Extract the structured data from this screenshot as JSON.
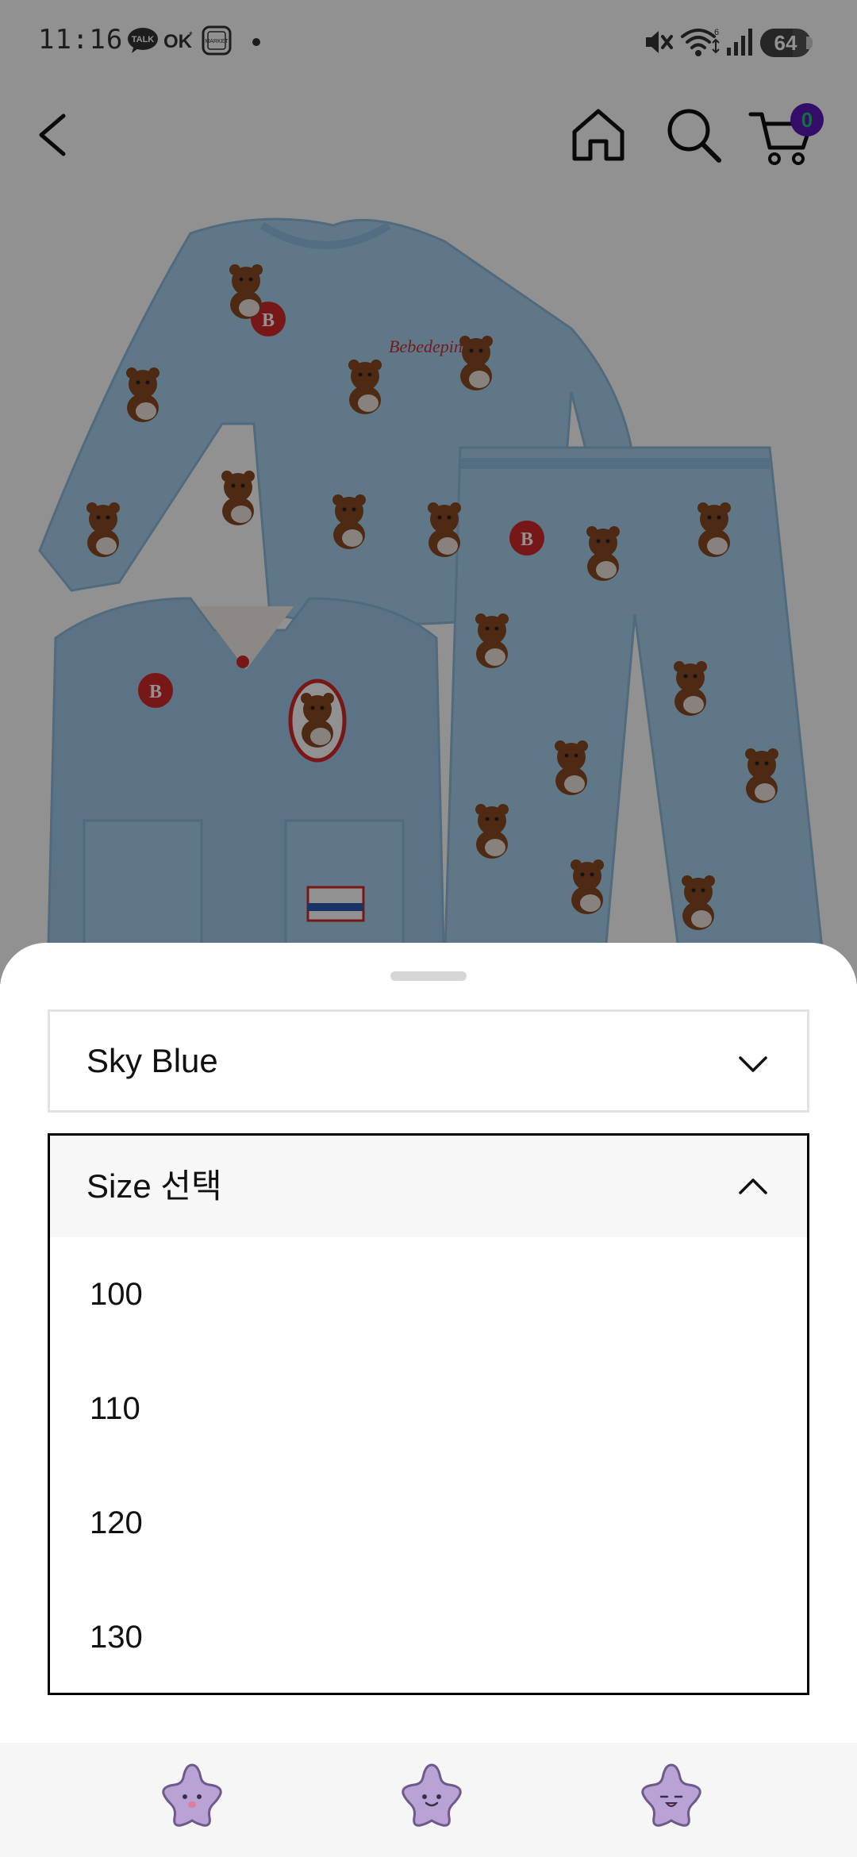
{
  "status_bar": {
    "time": "11:16",
    "notification_icons": [
      "kakaotalk-talk-icon",
      "ok-cashbag-icon",
      "market-app-icon",
      "dot-icon"
    ],
    "system_icons": [
      "mute-icon",
      "wifi-icon",
      "signal-icon"
    ],
    "battery_level": 64,
    "battery_text": "64"
  },
  "header": {
    "back_icon": "chevron-left-icon",
    "home_icon": "home-icon",
    "search_icon": "search-icon",
    "cart_icon": "cart-icon",
    "cart_count": "0"
  },
  "product_image": {
    "description_icon": "product-photo"
  },
  "sheet": {
    "color_select_value": "Sky Blue",
    "size_select_label": "Size 선택",
    "size_options": [
      "100",
      "110",
      "120",
      "130"
    ]
  },
  "bottom_nav": {
    "items": [
      "star-character-icon",
      "star-character-icon",
      "star-character-icon"
    ]
  },
  "colors": {
    "accent_badge": "#5b18b8",
    "badge_text": "#22c46b",
    "overlay": "rgba(0,0,0,0.43)",
    "garment": "#a9d2ee",
    "star": "#b9a2d4"
  }
}
